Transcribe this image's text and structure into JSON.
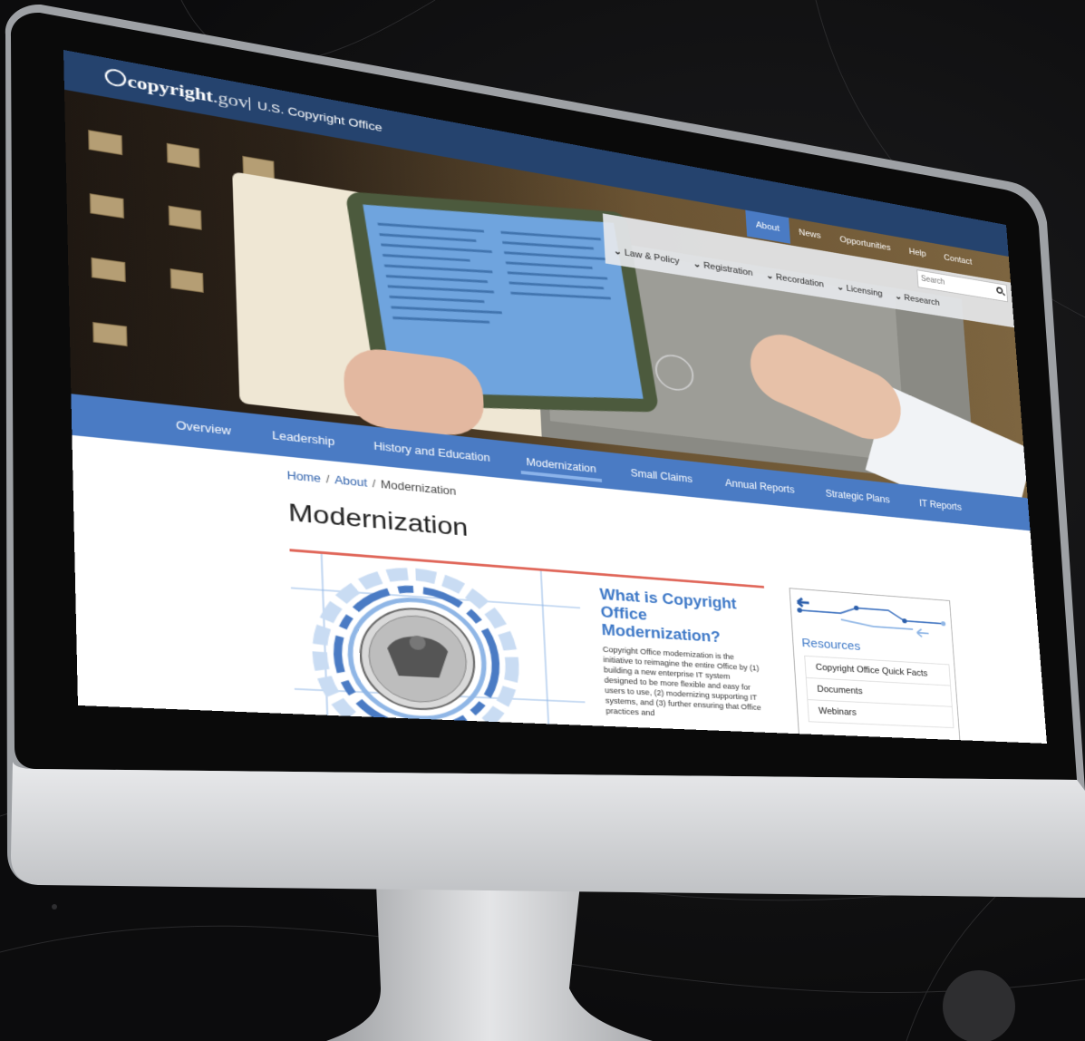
{
  "header": {
    "logo_main": "copyright",
    "logo_suffix": ".gov",
    "office_name": "U.S. Copyright Office"
  },
  "utility_nav": [
    "About",
    "News",
    "Opportunities",
    "Help",
    "Contact"
  ],
  "utility_nav_active": "About",
  "main_nav": [
    "Law & Policy",
    "Registration",
    "Recordation",
    "Licensing",
    "Research"
  ],
  "search": {
    "placeholder": "Search"
  },
  "subnav": [
    "Overview",
    "Leadership",
    "History and Education",
    "Modernization",
    "Small Claims",
    "Annual Reports",
    "Strategic Plans",
    "IT Reports"
  ],
  "subnav_active": "Modernization",
  "breadcrumb": {
    "home": "Home",
    "about": "About",
    "sep": "/",
    "current": "Modernization"
  },
  "page": {
    "title": "Modernization"
  },
  "feature": {
    "title": "What is Copyright Office Modernization?",
    "body": "Copyright Office modernization is the initiative to reimagine the entire Office by (1) building a new enterprise IT system designed to be more flexible and easy for users to use, (2) modernizing supporting IT systems, and (3) further ensuring that Office practices and"
  },
  "resources": {
    "title": "Resources",
    "items": [
      "Copyright Office Quick Facts",
      "Documents",
      "Webinars"
    ]
  },
  "colors": {
    "header_bg": "#25436e",
    "accent_blue": "#4a7bc4",
    "link_blue": "#2c5fab",
    "feature_border": "#e0675a"
  }
}
